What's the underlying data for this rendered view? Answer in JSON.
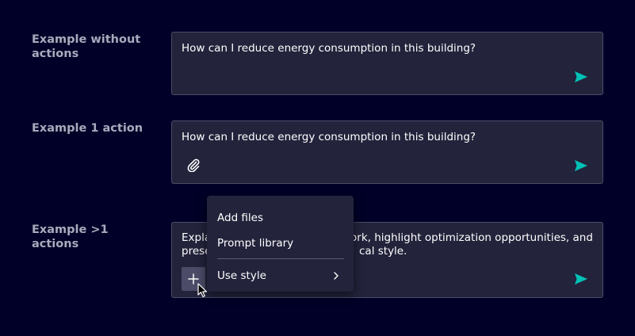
{
  "examples": {
    "without_actions": {
      "label": "Example without actions",
      "text": "How can I reduce energy consumption in this building?"
    },
    "one_action": {
      "label": "Example 1 action",
      "text": "How can I reduce energy consumption in this building?"
    },
    "multi_actions": {
      "label": "Example >1 actions",
      "text_line1_start": "Expla",
      "text_line1_end": "work, highlight optimization opportunities, and",
      "text_line2_start": "prese",
      "text_line2_end": "cal style."
    }
  },
  "menu": {
    "items": [
      {
        "label": "Add files"
      },
      {
        "label": "Prompt library"
      },
      {
        "label": "Use style"
      }
    ]
  },
  "icons": {
    "send": "send-icon",
    "attach": "paperclip-icon",
    "add": "plus-icon",
    "submenu": "chevron-right-icon",
    "cursor": "mouse-pointer-icon"
  },
  "colors": {
    "background": "#000028",
    "field": "#23233c",
    "border": "#4c4c68",
    "accent": "#00c1b6",
    "label": "#a9a9bd"
  }
}
